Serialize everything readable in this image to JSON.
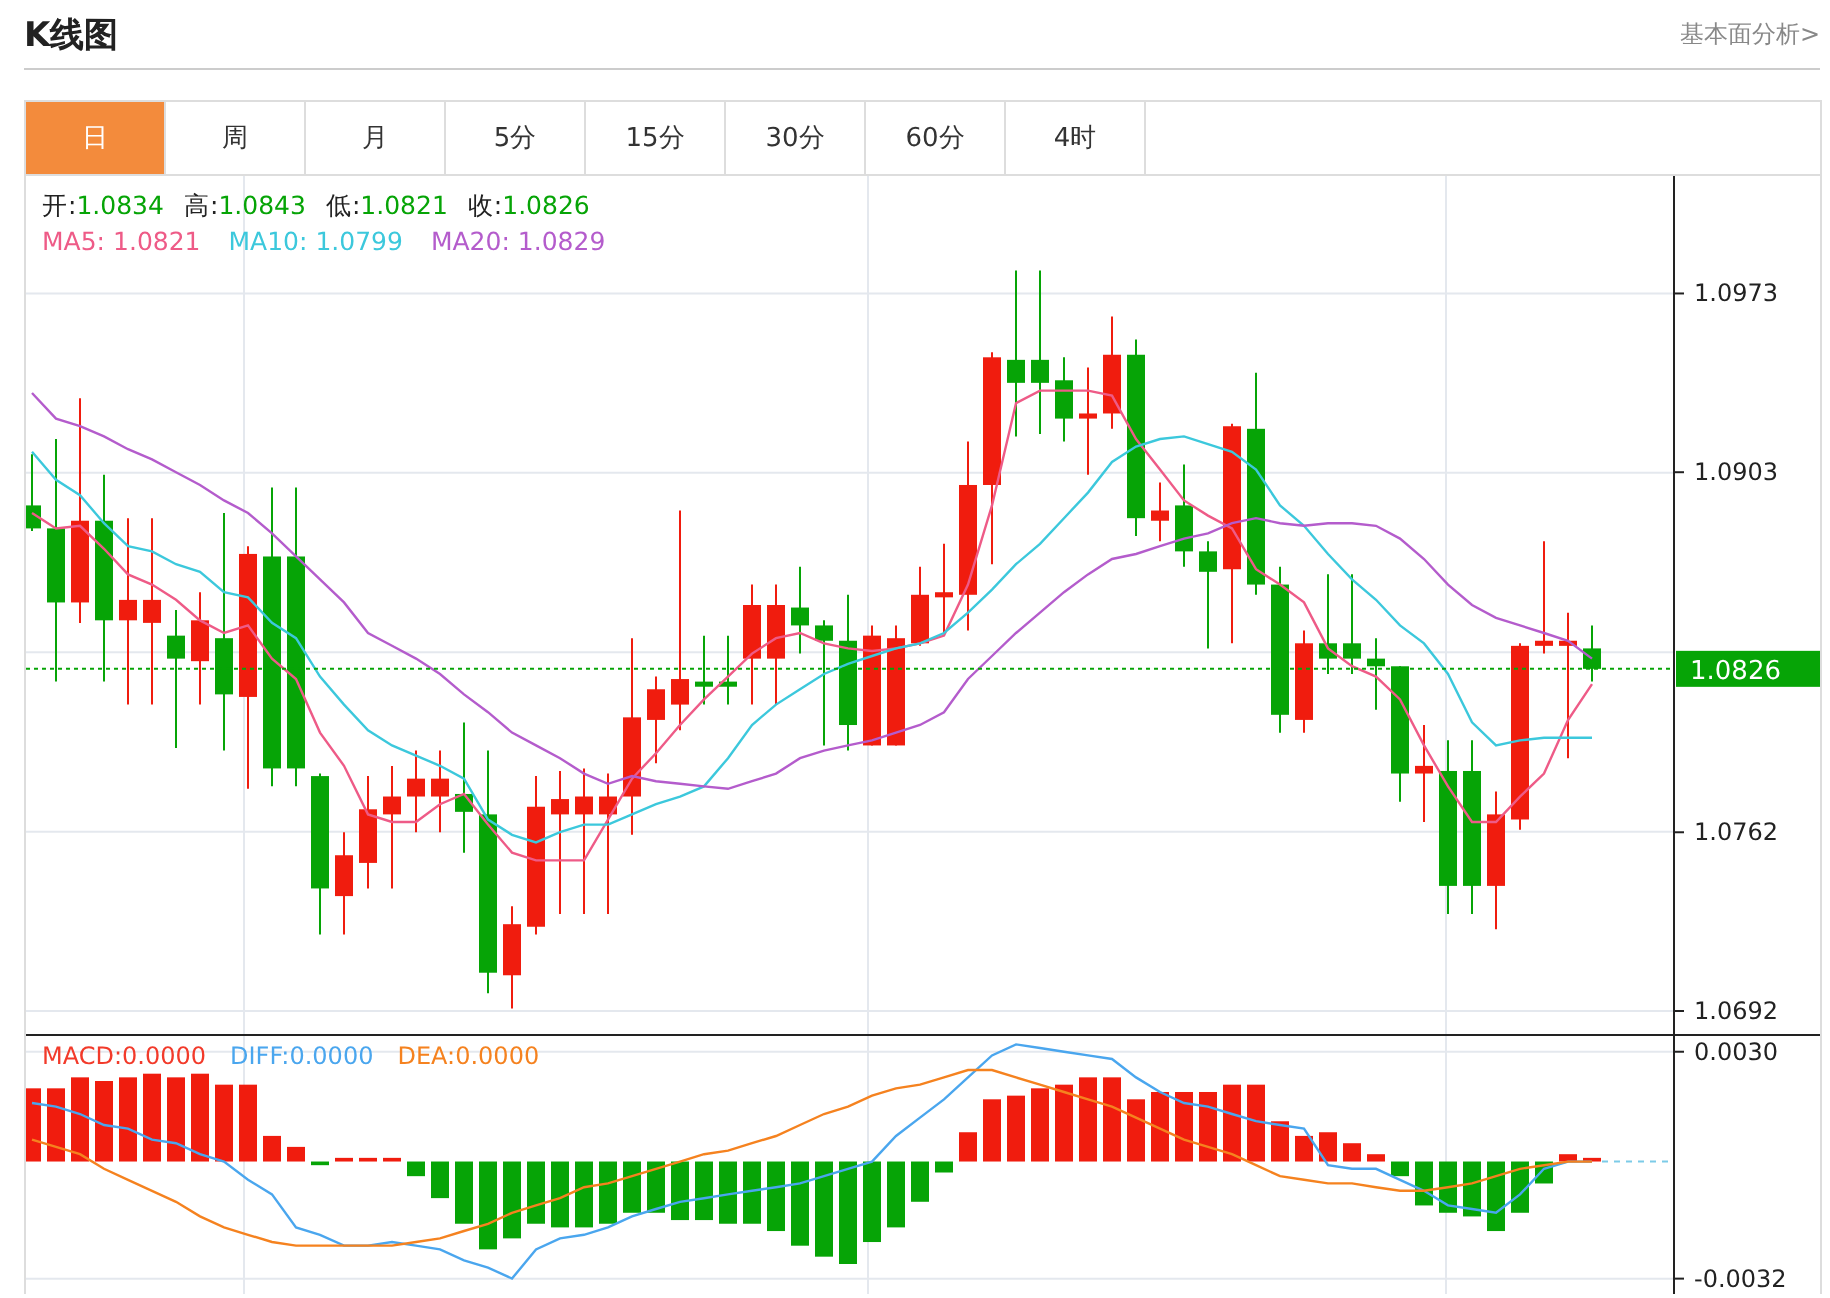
{
  "header": {
    "title": "K线图",
    "link": "基本面分析>"
  },
  "tabs": [
    {
      "label": "日",
      "selected": true
    },
    {
      "label": "周",
      "selected": false
    },
    {
      "label": "月",
      "selected": false
    },
    {
      "label": "5分",
      "selected": false
    },
    {
      "label": "15分",
      "selected": false
    },
    {
      "label": "30分",
      "selected": false
    },
    {
      "label": "60分",
      "selected": false
    },
    {
      "label": "4时",
      "selected": false
    }
  ],
  "quote": [
    {
      "label": "开:",
      "value": "1.0834"
    },
    {
      "label": "高:",
      "value": "1.0843"
    },
    {
      "label": "低:",
      "value": "1.0821"
    },
    {
      "label": "收:",
      "value": "1.0826"
    }
  ],
  "ma_values": [
    "1.0821",
    "1.0799",
    "1.0829"
  ],
  "price_chart": {
    "chart_data": {
      "type": "candlestick",
      "ylim": [
        1.0683,
        1.1019
      ],
      "yticks": [
        1.0973,
        1.0903,
        1.0762,
        1.0692
      ],
      "grid": true,
      "ref_lines": [
        {
          "axis": "y",
          "value": 1.0826,
          "label": "1.0826",
          "color": "#06a406"
        }
      ],
      "ohlc": [
        [
          1.089,
          1.091,
          1.088,
          1.0881
        ],
        [
          1.0881,
          1.0916,
          1.0821,
          1.0852
        ],
        [
          1.0852,
          1.0932,
          1.0844,
          1.0884
        ],
        [
          1.0884,
          1.0902,
          1.0821,
          1.0845
        ],
        [
          1.0845,
          1.0885,
          1.0812,
          1.0853
        ],
        [
          1.0844,
          1.0885,
          1.0812,
          1.0853
        ],
        [
          1.0839,
          1.0849,
          1.0795,
          1.083
        ],
        [
          1.0829,
          1.0856,
          1.0812,
          1.0845
        ],
        [
          1.0838,
          1.0887,
          1.0794,
          1.0816
        ],
        [
          1.0815,
          1.0874,
          1.0779,
          1.0871
        ],
        [
          1.087,
          1.0897,
          1.078,
          1.0787
        ],
        [
          1.087,
          1.0897,
          1.078,
          1.0787
        ],
        [
          1.0784,
          1.0785,
          1.0722,
          1.074
        ],
        [
          1.0737,
          1.0762,
          1.0722,
          1.0753
        ],
        [
          1.075,
          1.0784,
          1.074,
          1.0771
        ],
        [
          1.0769,
          1.0788,
          1.074,
          1.0776
        ],
        [
          1.0776,
          1.0794,
          1.0762,
          1.0783
        ],
        [
          1.0776,
          1.0794,
          1.0762,
          1.0783
        ],
        [
          1.0777,
          1.0805,
          1.0754,
          1.077
        ],
        [
          1.0769,
          1.0794,
          1.0699,
          1.0707
        ],
        [
          1.0706,
          1.0733,
          1.0693,
          1.0726
        ],
        [
          1.0725,
          1.0784,
          1.0722,
          1.0772
        ],
        [
          1.0769,
          1.0786,
          1.073,
          1.0775
        ],
        [
          1.0769,
          1.0787,
          1.073,
          1.0776
        ],
        [
          1.0769,
          1.0785,
          1.073,
          1.0776
        ],
        [
          1.0776,
          1.0838,
          1.0761,
          1.0807
        ],
        [
          1.0806,
          1.0823,
          1.0789,
          1.0818
        ],
        [
          1.0812,
          1.0888,
          1.0802,
          1.0822
        ],
        [
          1.0821,
          1.0839,
          1.0812,
          1.0819
        ],
        [
          1.0821,
          1.0839,
          1.0812,
          1.0819
        ],
        [
          1.083,
          1.0859,
          1.0812,
          1.0851
        ],
        [
          1.083,
          1.0859,
          1.0812,
          1.0851
        ],
        [
          1.085,
          1.0866,
          1.0832,
          1.0843
        ],
        [
          1.0843,
          1.0845,
          1.0796,
          1.0837
        ],
        [
          1.0837,
          1.0855,
          1.0794,
          1.0804
        ],
        [
          1.0796,
          1.0843,
          1.0796,
          1.0839
        ],
        [
          1.0796,
          1.0843,
          1.0796,
          1.0838
        ],
        [
          1.0836,
          1.0866,
          1.0835,
          1.0855
        ],
        [
          1.0854,
          1.0875,
          1.084,
          1.0856
        ],
        [
          1.0855,
          1.0915,
          1.0841,
          1.0898
        ],
        [
          1.0898,
          1.095,
          1.0867,
          1.0948
        ],
        [
          1.0947,
          1.0982,
          1.0917,
          1.0938
        ],
        [
          1.0947,
          1.0982,
          1.0918,
          1.0938
        ],
        [
          1.0939,
          1.0948,
          1.0915,
          1.0924
        ],
        [
          1.0924,
          1.0944,
          1.0902,
          1.0926
        ],
        [
          1.0926,
          1.0964,
          1.092,
          1.0949
        ],
        [
          1.0949,
          1.0955,
          1.0878,
          1.0885
        ],
        [
          1.0884,
          1.0899,
          1.0876,
          1.0888
        ],
        [
          1.089,
          1.0906,
          1.0866,
          1.0872
        ],
        [
          1.0872,
          1.0876,
          1.0834,
          1.0864
        ],
        [
          1.0865,
          1.0922,
          1.0836,
          1.0921
        ],
        [
          1.092,
          1.0942,
          1.0855,
          1.0859
        ],
        [
          1.0859,
          1.0866,
          1.0801,
          1.0808
        ],
        [
          1.0806,
          1.0841,
          1.0801,
          1.0836
        ],
        [
          1.0836,
          1.0863,
          1.0824,
          1.083
        ],
        [
          1.0836,
          1.0863,
          1.0824,
          1.083
        ],
        [
          1.083,
          1.0838,
          1.081,
          1.0827
        ],
        [
          1.0827,
          1.0827,
          1.0774,
          1.0785
        ],
        [
          1.0785,
          1.0804,
          1.0766,
          1.0788
        ],
        [
          1.0786,
          1.0798,
          1.073,
          1.0741
        ],
        [
          1.0786,
          1.0798,
          1.073,
          1.0741
        ],
        [
          1.0741,
          1.0778,
          1.0724,
          1.0769
        ],
        [
          1.0767,
          1.0836,
          1.0763,
          1.0835
        ],
        [
          1.0835,
          1.0876,
          1.0832,
          1.0837
        ],
        [
          1.0835,
          1.0848,
          1.0791,
          1.0837
        ],
        [
          1.0834,
          1.0843,
          1.0821,
          1.0826
        ]
      ],
      "series": [
        {
          "name": "MA5:",
          "type": "line",
          "color": "#ee5b87",
          "values": [
            1.0887,
            1.0881,
            1.0882,
            1.0873,
            1.0863,
            1.0859,
            1.0853,
            1.0845,
            1.084,
            1.0843,
            1.083,
            1.0822,
            1.0801,
            1.0788,
            1.0769,
            1.0766,
            1.0766,
            1.0773,
            1.0777,
            1.0765,
            1.0754,
            1.0751,
            1.0751,
            1.0751,
            1.0767,
            1.0783,
            1.0793,
            1.0804,
            1.0814,
            1.0823,
            1.0832,
            1.0838,
            1.084,
            1.0836,
            1.0834,
            1.0833,
            1.0834,
            1.0836,
            1.0839,
            1.0859,
            1.089,
            1.093,
            1.0935,
            1.0935,
            1.0935,
            1.0933,
            1.0916,
            1.0904,
            1.0892,
            1.0886,
            1.0881,
            1.0865,
            1.0859,
            1.0852,
            1.0834,
            1.0827,
            1.0823,
            1.0814,
            1.0796,
            1.078,
            1.0766,
            1.0766,
            1.0776,
            1.0785,
            1.0806,
            1.082
          ]
        },
        {
          "name": "MA10:",
          "type": "line",
          "color": "#3cc8dc",
          "values": [
            1.0911,
            1.09,
            1.0894,
            1.0883,
            1.0874,
            1.0872,
            1.0867,
            1.0864,
            1.0856,
            1.0854,
            1.0844,
            1.0838,
            1.0823,
            1.0812,
            1.0802,
            1.0796,
            1.0792,
            1.0788,
            1.0783,
            1.0767,
            1.0761,
            1.0758,
            1.0762,
            1.0765,
            1.0765,
            1.0769,
            1.0773,
            1.0776,
            1.078,
            1.0791,
            1.0804,
            1.0812,
            1.0818,
            1.0824,
            1.0828,
            1.0831,
            1.0834,
            1.0836,
            1.084,
            1.0848,
            1.0857,
            1.0867,
            1.0875,
            1.0885,
            1.0895,
            1.0907,
            1.0913,
            1.0916,
            1.0917,
            1.0914,
            1.0911,
            1.0904,
            1.089,
            1.0882,
            1.0871,
            1.0861,
            1.0853,
            1.0843,
            1.0836,
            1.0824,
            1.0805,
            1.0796,
            1.0798,
            1.0799,
            1.0799,
            1.0799
          ]
        },
        {
          "name": "MA20:",
          "type": "line",
          "color": "#b45ccc",
          "values": [
            1.0934,
            1.0924,
            1.0921,
            1.0917,
            1.0912,
            1.0908,
            1.0903,
            1.0898,
            1.0892,
            1.0887,
            1.0879,
            1.087,
            1.0861,
            1.0852,
            1.084,
            1.0835,
            1.083,
            1.0824,
            1.0816,
            1.0809,
            1.0801,
            1.0796,
            1.0791,
            1.0785,
            1.0781,
            1.0784,
            1.0782,
            1.0781,
            1.078,
            1.0779,
            1.0782,
            1.0785,
            1.0791,
            1.0794,
            1.0796,
            1.0798,
            1.0801,
            1.0804,
            1.0809,
            1.0822,
            1.0831,
            1.084,
            1.0848,
            1.0856,
            1.0863,
            1.0869,
            1.0871,
            1.0874,
            1.0877,
            1.0879,
            1.0883,
            1.0885,
            1.0883,
            1.0882,
            1.0883,
            1.0883,
            1.0882,
            1.0877,
            1.0869,
            1.0859,
            1.0851,
            1.0846,
            1.0843,
            1.084,
            1.0837,
            1.083
          ]
        }
      ]
    }
  },
  "macd_values": [
    "0.0000",
    "0.0000",
    "0.0000"
  ],
  "macd_chart": {
    "chart_data": {
      "type": "bar",
      "ylim": [
        -0.00362,
        0.00343
      ],
      "yticks": [
        {
          "value": 0.003,
          "label": "0.0030"
        },
        -0.0032
      ],
      "grid": true,
      "series": [
        {
          "name": "MACD:",
          "type": "bar",
          "color": "#f23a2a",
          "colors": [
            "#f01c0e",
            "#f01c0e",
            "#f01c0e",
            "#f01c0e",
            "#f01c0e",
            "#f01c0e",
            "#f01c0e",
            "#f01c0e",
            "#f01c0e",
            "#f01c0e",
            "#f01c0e",
            "#f01c0e",
            "#06a406",
            "#f01c0e",
            "#f01c0e",
            "#f01c0e",
            "#06a406",
            "#06a406",
            "#06a406",
            "#06a406",
            "#06a406",
            "#06a406",
            "#06a406",
            "#06a406",
            "#06a406",
            "#06a406",
            "#06a406",
            "#06a406",
            "#06a406",
            "#06a406",
            "#06a406",
            "#06a406",
            "#06a406",
            "#06a406",
            "#06a406",
            "#06a406",
            "#06a406",
            "#06a406",
            "#06a406",
            "#f01c0e",
            "#f01c0e",
            "#f01c0e",
            "#f01c0e",
            "#f01c0e",
            "#f01c0e",
            "#f01c0e",
            "#f01c0e",
            "#f01c0e",
            "#f01c0e",
            "#f01c0e",
            "#f01c0e",
            "#f01c0e",
            "#f01c0e",
            "#f01c0e",
            "#f01c0e",
            "#f01c0e",
            "#f01c0e",
            "#06a406",
            "#06a406",
            "#06a406",
            "#06a406",
            "#06a406",
            "#06a406",
            "#06a406",
            "#f01c0e",
            "#f01c0e"
          ],
          "values": [
            0.002,
            0.002,
            0.0023,
            0.0022,
            0.0023,
            0.0024,
            0.0023,
            0.0024,
            0.0021,
            0.0021,
            0.0007,
            0.0004,
            -0.0001,
            0.0001,
            0.0001,
            0.0001,
            -0.0004,
            -0.001,
            -0.0017,
            -0.0024,
            -0.0021,
            -0.0017,
            -0.0018,
            -0.0018,
            -0.0017,
            -0.0014,
            -0.0014,
            -0.0016,
            -0.0016,
            -0.0017,
            -0.0017,
            -0.0019,
            -0.0023,
            -0.0026,
            -0.0028,
            -0.0022,
            -0.0018,
            -0.0011,
            -0.0003,
            0.0008,
            0.0017,
            0.0018,
            0.002,
            0.0021,
            0.0023,
            0.0023,
            0.0017,
            0.0019,
            0.0019,
            0.0019,
            0.0021,
            0.0021,
            0.0011,
            0.0007,
            0.0008,
            0.0005,
            0.0002,
            -0.0004,
            -0.0012,
            -0.0014,
            -0.0015,
            -0.0019,
            -0.0014,
            -0.0006,
            0.0002,
            0.0001
          ]
        },
        {
          "name": "DIFF:",
          "type": "line",
          "color": "#4aa6ee",
          "values": [
            0.0016,
            0.0015,
            0.0013,
            0.001,
            0.0009,
            0.0006,
            0.0005,
            0.0002,
            0.0,
            -0.0005,
            -0.0009,
            -0.0018,
            -0.002,
            -0.0023,
            -0.0023,
            -0.0022,
            -0.0023,
            -0.0024,
            -0.0027,
            -0.0029,
            -0.0032,
            -0.0024,
            -0.0021,
            -0.002,
            -0.0018,
            -0.0015,
            -0.0013,
            -0.0011,
            -0.001,
            -0.0009,
            -0.0008,
            -0.0007,
            -0.0006,
            -0.0004,
            -0.0002,
            0.0,
            0.0007,
            0.0012,
            0.0017,
            0.0023,
            0.0029,
            0.0032,
            0.0031,
            0.003,
            0.0029,
            0.0028,
            0.0023,
            0.0019,
            0.0016,
            0.0015,
            0.0013,
            0.0011,
            0.001,
            0.0009,
            -0.0001,
            -0.0002,
            -0.0002,
            -0.0005,
            -0.0008,
            -0.0012,
            -0.0013,
            -0.0014,
            -0.0009,
            -0.0002,
            0.0,
            0.0
          ]
        },
        {
          "name": "DEA:",
          "type": "line",
          "color": "#f5821f",
          "values": [
            0.0006,
            0.0004,
            0.0002,
            -0.0002,
            -0.0005,
            -0.0008,
            -0.0011,
            -0.0015,
            -0.0018,
            -0.002,
            -0.0022,
            -0.0023,
            -0.0023,
            -0.0023,
            -0.0023,
            -0.0023,
            -0.0022,
            -0.0021,
            -0.0019,
            -0.0017,
            -0.0014,
            -0.0012,
            -0.001,
            -0.0007,
            -0.0006,
            -0.0004,
            -0.0002,
            0.0,
            0.0002,
            0.0003,
            0.0005,
            0.0007,
            0.001,
            0.0013,
            0.0015,
            0.0018,
            0.002,
            0.0021,
            0.0023,
            0.0025,
            0.0025,
            0.0023,
            0.0021,
            0.0019,
            0.0017,
            0.0015,
            0.0012,
            0.0009,
            0.0006,
            0.0004,
            0.0002,
            -0.0001,
            -0.0004,
            -0.0005,
            -0.0006,
            -0.0006,
            -0.0007,
            -0.0008,
            -0.0008,
            -0.0007,
            -0.0006,
            -0.0004,
            -0.0002,
            -0.0001,
            0.0,
            0.0
          ]
        }
      ]
    }
  }
}
